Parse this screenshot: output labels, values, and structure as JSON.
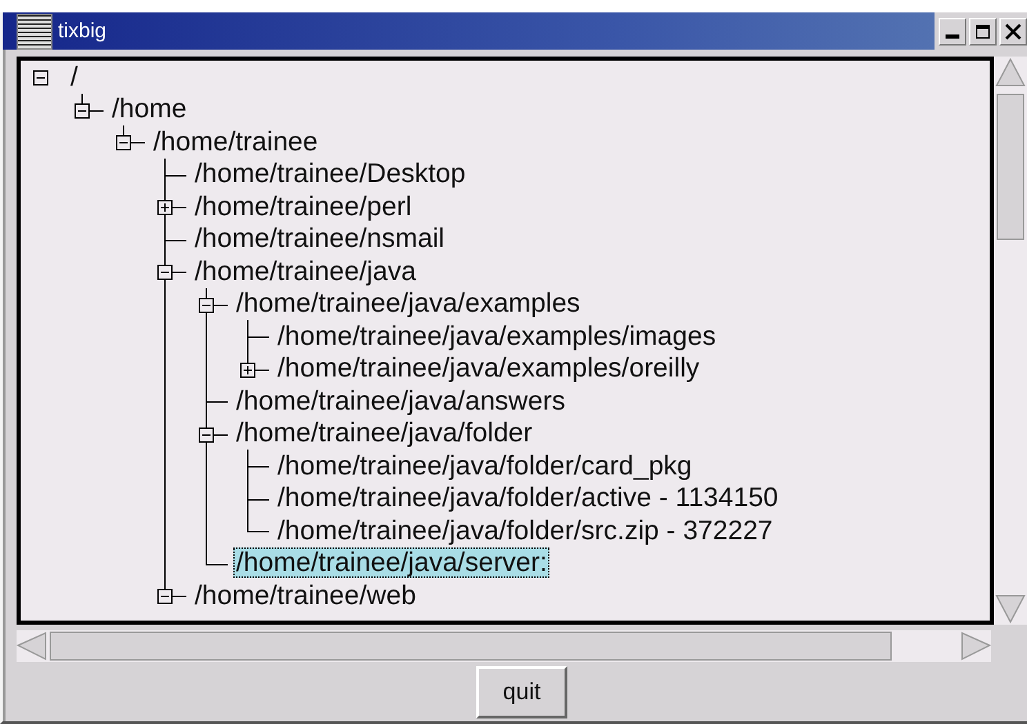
{
  "window": {
    "title": "tixbig"
  },
  "tree": [
    {
      "label": "/",
      "expanded": true,
      "selected": false,
      "children": [
        {
          "label": "/home",
          "expanded": true,
          "selected": false,
          "children": [
            {
              "label": "/home/trainee",
              "expanded": true,
              "selected": false,
              "children": [
                {
                  "label": "/home/trainee/Desktop",
                  "selected": false
                },
                {
                  "label": "/home/trainee/perl",
                  "expanded": false,
                  "selected": false
                },
                {
                  "label": "/home/trainee/nsmail",
                  "selected": false
                },
                {
                  "label": "/home/trainee/java",
                  "expanded": true,
                  "selected": false,
                  "children": [
                    {
                      "label": "/home/trainee/java/examples",
                      "expanded": true,
                      "selected": false,
                      "children": [
                        {
                          "label": "/home/trainee/java/examples/images",
                          "selected": false
                        },
                        {
                          "label": "/home/trainee/java/examples/oreilly",
                          "expanded": false,
                          "selected": false
                        }
                      ]
                    },
                    {
                      "label": "/home/trainee/java/answers",
                      "selected": false
                    },
                    {
                      "label": "/home/trainee/java/folder",
                      "expanded": true,
                      "selected": false,
                      "children": [
                        {
                          "label": "/home/trainee/java/folder/card_pkg",
                          "selected": false
                        },
                        {
                          "label": "/home/trainee/java/folder/active - 1134150",
                          "selected": false
                        },
                        {
                          "label": "/home/trainee/java/folder/src.zip - 372227",
                          "selected": false
                        }
                      ]
                    },
                    {
                      "label": "/home/trainee/java/server:",
                      "selected": true
                    }
                  ]
                },
                {
                  "label": "/home/trainee/web",
                  "expanded": true,
                  "selected": false
                }
              ]
            }
          ]
        }
      ]
    }
  ],
  "button": {
    "label": "quit"
  }
}
